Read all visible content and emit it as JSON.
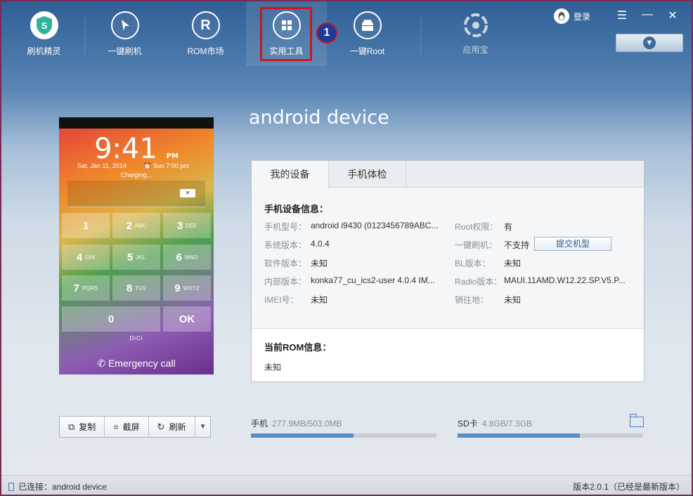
{
  "toolbar": {
    "items": [
      {
        "label": "刷机精灵",
        "icon": "shield-s-icon"
      },
      {
        "label": "一键刷机",
        "icon": "cursor-icon"
      },
      {
        "label": "ROM市场",
        "icon": "r-icon"
      },
      {
        "label": "实用工具",
        "icon": "grid-icon"
      },
      {
        "label": "一键Root",
        "icon": "android-icon"
      },
      {
        "label": "应用宝",
        "icon": "pinwheel-icon"
      }
    ],
    "callout_number": "1",
    "login_label": "登录",
    "window_menu": "☰",
    "window_minimize": "—",
    "window_close": "✕"
  },
  "device": {
    "title": "android device"
  },
  "phone_screen": {
    "time": "9:41",
    "ampm": "PM",
    "date": "Sat, Jan 11, 2014",
    "alarm": "Sun 7:00 pm",
    "charging": "Charging...",
    "keys": [
      {
        "num": "1",
        "letters": ""
      },
      {
        "num": "2",
        "letters": "ABC"
      },
      {
        "num": "3",
        "letters": "DEF"
      },
      {
        "num": "4",
        "letters": "GHI"
      },
      {
        "num": "5",
        "letters": "JKL"
      },
      {
        "num": "6",
        "letters": "MNO"
      },
      {
        "num": "7",
        "letters": "PQRS"
      },
      {
        "num": "8",
        "letters": "TUV"
      },
      {
        "num": "9",
        "letters": "WXYZ"
      },
      {
        "num": "0",
        "letters": ""
      },
      {
        "num": "OK",
        "letters": ""
      }
    ],
    "brand": "DiCi",
    "emergency": "Emergency call"
  },
  "panel": {
    "tabs": [
      "我的设备",
      "手机体检"
    ],
    "device_info_title": "手机设备信息：",
    "left_rows": [
      {
        "label": "手机型号：",
        "value": "android i9430 (0123456789ABC..."
      },
      {
        "label": "系统版本：",
        "value": "4.0.4"
      },
      {
        "label": "软件版本：",
        "value": "未知"
      },
      {
        "label": "内部版本：",
        "value": "konka77_cu_ics2-user 4.0.4 IM..."
      },
      {
        "label": "IMEI号：",
        "value": "未知"
      }
    ],
    "right_rows": [
      {
        "label": "Root权限：",
        "value": "有"
      },
      {
        "label": "一键刷机：",
        "value": "不支持"
      },
      {
        "label": "BL版本：",
        "value": "未知"
      },
      {
        "label": "Radio版本：",
        "value": "MAUI.11AMD.W12.22.SP.V5.P..."
      },
      {
        "label": "销往地：",
        "value": "未知"
      }
    ],
    "submit_model_label": "提交机型",
    "rom_info_title": "当前ROM信息：",
    "rom_info_value": "未知"
  },
  "actions": {
    "copy": "复制",
    "screenshot": "截屏",
    "refresh": "刷新"
  },
  "storage": {
    "phone_label": "手机",
    "phone_value": "277.9MB/503.0MB",
    "phone_fraction": 0.5525,
    "sd_label": "SD卡",
    "sd_value": "4.8GB/7.3GB",
    "sd_fraction": 0.6575
  },
  "status": {
    "connected": "已连接：android device",
    "version": "版本2.0.1（已经是最新版本）"
  },
  "colors": {
    "accent": "#5a8cc6",
    "highlight_red": "#c8181e",
    "callout_blue": "#1d3a9a"
  }
}
